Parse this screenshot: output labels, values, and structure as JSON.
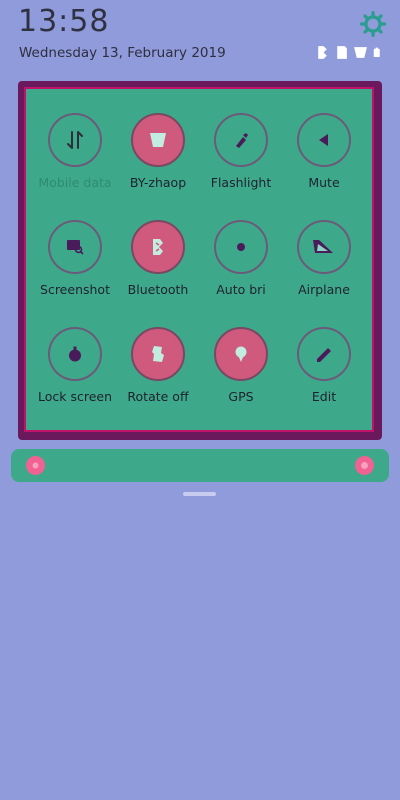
{
  "status": {
    "time": "13:58",
    "date": "Wednesday 13, February 2019"
  },
  "colors": {
    "background": "#8f9bda",
    "panel": "#3ea98a",
    "panel_border": "#c0126a",
    "tile_on": "#cf5a7e",
    "accent": "#f06292"
  },
  "tiles": [
    {
      "label": "Mobile data",
      "icon": "data-arrows-icon",
      "active": false,
      "dimmed": true
    },
    {
      "label": "BY-zhaop",
      "icon": "wifi-icon",
      "active": true
    },
    {
      "label": "Flashlight",
      "icon": "flashlight-icon",
      "active": false
    },
    {
      "label": "Mute",
      "icon": "mute-icon",
      "active": false
    },
    {
      "label": "Screenshot",
      "icon": "screenshot-icon",
      "active": false
    },
    {
      "label": "Bluetooth",
      "icon": "bluetooth-icon",
      "active": true
    },
    {
      "label": "Auto bri",
      "icon": "auto-brightness-icon",
      "active": false
    },
    {
      "label": "Airplane",
      "icon": "airplane-icon",
      "active": false
    },
    {
      "label": "Lock screen",
      "icon": "lock-icon",
      "active": false
    },
    {
      "label": "Rotate off",
      "icon": "rotate-icon",
      "active": true
    },
    {
      "label": "GPS",
      "icon": "location-icon",
      "active": true
    },
    {
      "label": "Edit",
      "icon": "edit-icon",
      "active": false
    }
  ]
}
